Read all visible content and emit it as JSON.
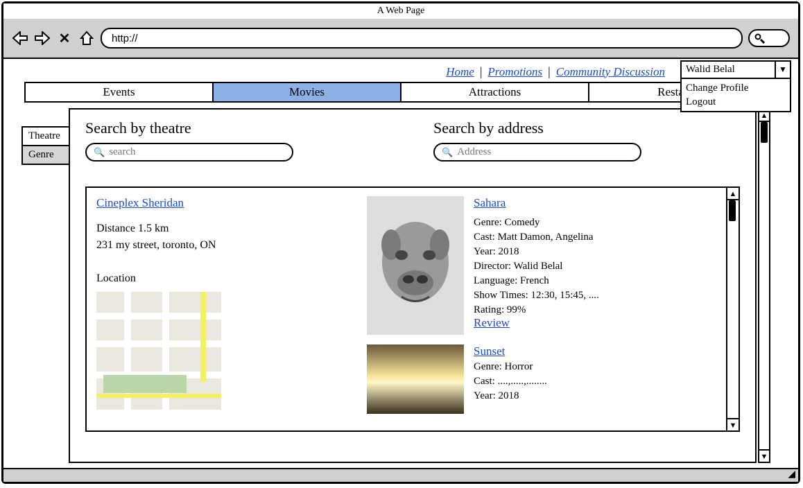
{
  "browser": {
    "title": "A Web Page",
    "url": "http://"
  },
  "topnav": {
    "links": [
      "Home",
      "Promotions",
      "Community Discussion"
    ]
  },
  "user": {
    "name": "Walid Belal",
    "menu": [
      "Change Profile",
      "Logout"
    ]
  },
  "tabs": {
    "items": [
      "Events",
      "Movies",
      "Attractions",
      "Restaurant"
    ],
    "active": 1
  },
  "sideTabs": {
    "items": [
      "Theatre",
      "Genre"
    ],
    "active": 0
  },
  "search": {
    "theatre": {
      "heading": "Search by theatre",
      "placeholder": "search"
    },
    "address": {
      "heading": "Search by address",
      "placeholder": "Address"
    }
  },
  "theatre": {
    "name": "Cineplex Sheridan",
    "distance": "Distance 1.5 km",
    "address": "231 my street, toronto, ON",
    "locationLabel": "Location"
  },
  "movies": [
    {
      "title": "Sahara",
      "genre": "Genre: Comedy",
      "cast": "Cast: Matt Damon, Angelina",
      "year": "Year: 2018",
      "director": "Director: Walid Belal",
      "language": "Language: French",
      "showtimes": "Show Times: 12:30, 15:45, ....",
      "rating": "Rating: 99%",
      "reviewLink": "Review"
    },
    {
      "title": "Sunset",
      "genre": "Genre: Horror",
      "cast": "Cast: ....,.....,........",
      "year": "Year: 2018"
    }
  ]
}
